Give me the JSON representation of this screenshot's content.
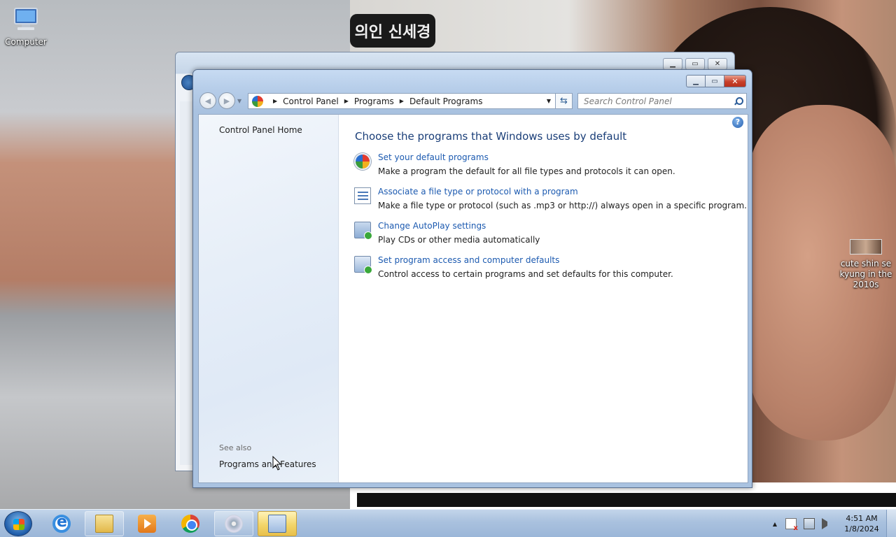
{
  "desktop": {
    "icons": [
      {
        "label": "Computer",
        "icon": "computer-icon"
      },
      {
        "label": "cute shin se kyung in the 2010s",
        "icon": "image-thumbnail-icon"
      }
    ],
    "wallpaper_text": "의인 신세경"
  },
  "window": {
    "breadcrumb": [
      "Control Panel",
      "Programs",
      "Default Programs"
    ],
    "search_placeholder": "Search Control Panel",
    "left_pane": {
      "home_link": "Control Panel Home",
      "see_also_label": "See also",
      "see_also_links": [
        "Programs and Features"
      ]
    },
    "main": {
      "title": "Choose the programs that Windows uses by default",
      "tasks": [
        {
          "link": "Set your default programs",
          "description": "Make a program the default for all file types and protocols it can open.",
          "icon": "default-programs-icon"
        },
        {
          "link": "Associate a file type or protocol with a program",
          "description": "Make a file type or protocol (such as .mp3 or http://) always open in a specific program.",
          "icon": "file-association-icon"
        },
        {
          "link": "Change AutoPlay settings",
          "description": "Play CDs or other media automatically",
          "icon": "autoplay-icon"
        },
        {
          "link": "Set program access and computer defaults",
          "description": "Control access to certain programs and set defaults for this computer.",
          "icon": "program-access-icon"
        }
      ]
    }
  },
  "taskbar": {
    "items": [
      {
        "name": "internet-explorer",
        "icon": "ie-icon"
      },
      {
        "name": "windows-explorer",
        "icon": "folder-icon"
      },
      {
        "name": "media-player",
        "icon": "media-player-icon"
      },
      {
        "name": "google-chrome",
        "icon": "chrome-icon"
      },
      {
        "name": "dvd-maker",
        "icon": "dvd-icon"
      },
      {
        "name": "control-panel",
        "icon": "control-panel-icon"
      }
    ],
    "clock": {
      "time": "4:51 AM",
      "date": "1/8/2024"
    }
  },
  "colors": {
    "link": "#1c5ab0",
    "heading": "#1a3e78",
    "close_button": "#c8402a",
    "taskbar": "#a9c1de"
  }
}
